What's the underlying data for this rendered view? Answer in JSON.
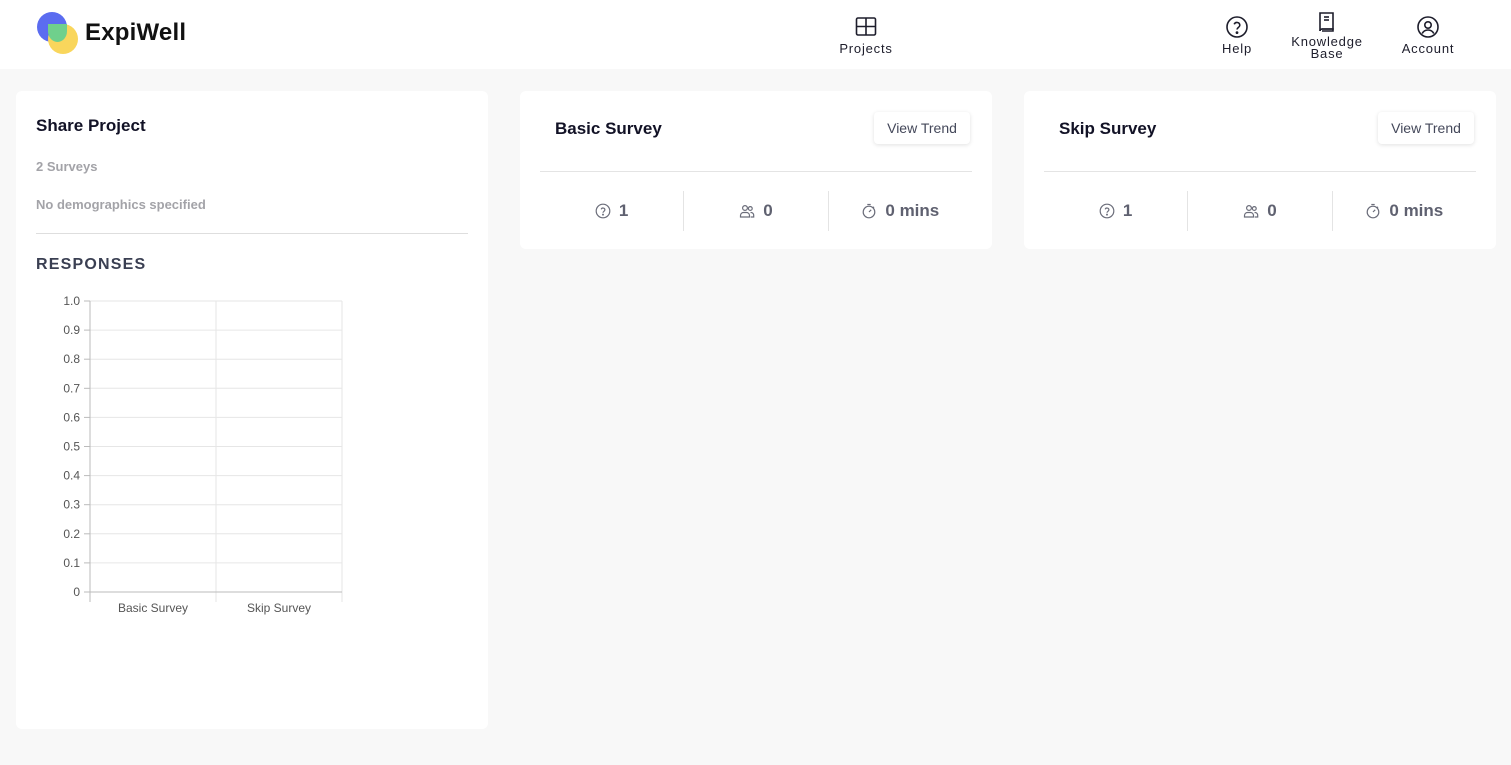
{
  "app": {
    "name": "ExpiWell"
  },
  "nav": {
    "projects": "Projects",
    "help": "Help",
    "knowledge_line1": "Knowledge",
    "knowledge_line2": "Base",
    "account": "Account"
  },
  "share": {
    "title": "Share Project",
    "surveys_count": "2 Surveys",
    "demographics": "No demographics specified",
    "responses_title": "RESPONSES"
  },
  "chart_data": {
    "type": "bar",
    "categories": [
      "Basic Survey",
      "Skip Survey"
    ],
    "values": [
      0,
      0
    ],
    "title": "",
    "xlabel": "",
    "ylabel": "",
    "ylim": [
      0,
      1
    ],
    "yticks": [
      "1.0",
      "0.9",
      "0.8",
      "0.7",
      "0.6",
      "0.5",
      "0.4",
      "0.3",
      "0.2",
      "0.1",
      "0"
    ],
    "grid": true
  },
  "surveys": [
    {
      "title": "Basic Survey",
      "trend_label": "View Trend",
      "questions": "1",
      "participants": "0",
      "duration": "0 mins"
    },
    {
      "title": "Skip Survey",
      "trend_label": "View Trend",
      "questions": "1",
      "participants": "0",
      "duration": "0 mins"
    }
  ],
  "colors": {
    "accent_blue": "#5b6cf0",
    "accent_yellow": "#f9d65c",
    "accent_green": "#6fd08c"
  }
}
